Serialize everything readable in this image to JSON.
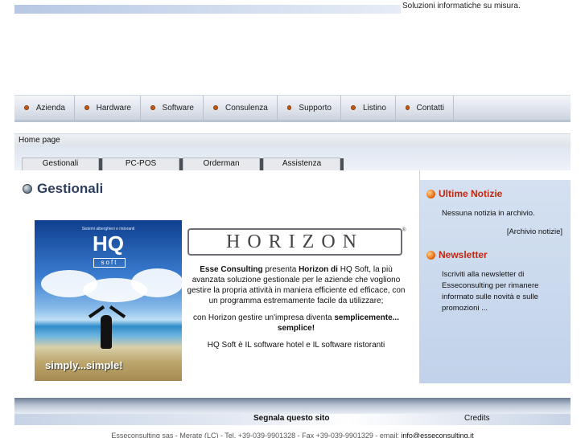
{
  "header": {
    "tagline": "Soluzioni informatiche su misura."
  },
  "nav": {
    "items": [
      {
        "label": "Azienda"
      },
      {
        "label": "Hardware"
      },
      {
        "label": "Software"
      },
      {
        "label": "Consulenza"
      },
      {
        "label": "Supporto"
      },
      {
        "label": "Listino"
      },
      {
        "label": "Contatti"
      }
    ]
  },
  "breadcrumb": "Home page",
  "tabs": [
    {
      "label": "Gestionali"
    },
    {
      "label": "PC-POS"
    },
    {
      "label": "Orderman"
    },
    {
      "label": "Assistenza"
    }
  ],
  "main": {
    "title": "Gestionali",
    "image": {
      "tiny_text": "Sistemi alberghieri e ristoranti",
      "brand": "HQ",
      "soft": "soft",
      "slogan": "simply...simple!"
    },
    "horizon_logo": "HORIZON",
    "horizon_reg": "®",
    "para1_bold1": "Esse Consulting",
    "para1_text1": " presenta ",
    "para1_bold2": "Horizon di",
    "para1_text2": " HQ Soft, la più avanzata soluzione gestionale per le aziende che vogliono gestire la propria attività in maniera efficiente ed efficace, con un programma estremamente facile da utilizzare;",
    "para2_text": "con Horizon gestire un'impresa diventa ",
    "para2_bold": "semplicemente... semplice!",
    "para3": "HQ Soft è IL software hotel e IL software ristoranti"
  },
  "sidebar": {
    "news_title": "Ultime Notizie",
    "news_text": "Nessuna notizia in archivio.",
    "archive_link": "[Archivio notizie]",
    "newsletter_title": "Newsletter",
    "newsletter_text": "Iscriviti alla newsletter di Esseconsulting per rimanere informato sulle novità e sulle promozioni ..."
  },
  "footer": {
    "signal": "Segnala questo sito",
    "credits": "Credits",
    "info": "Esseconsulting sas - Merate (LC) - Tel. +39-039-9901328 - Fax +39-039-9901329 - email: ",
    "email": "info@esseconsulting.it"
  },
  "colors": {
    "accent_red": "#c0280f",
    "title_blue": "#2d3d5c",
    "sidebar_bg": "#c9d8ee",
    "bullet_orange": "#c55a14"
  }
}
